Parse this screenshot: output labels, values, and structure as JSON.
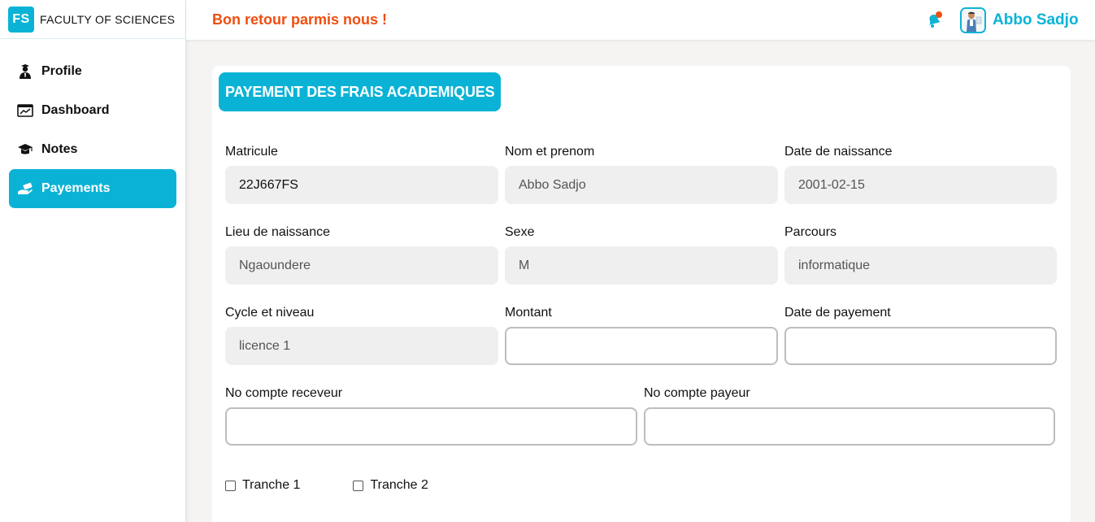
{
  "brand": {
    "logo": "FS",
    "name": "FACULTY OF SCIENCES"
  },
  "sidebar": {
    "items": [
      {
        "label": "Profile",
        "icon": "student-icon"
      },
      {
        "label": "Dashboard",
        "icon": "dashboard-icon"
      },
      {
        "label": "Notes",
        "icon": "graduation-cap-icon"
      },
      {
        "label": "Payements",
        "icon": "hand-money-icon",
        "active": true
      }
    ]
  },
  "header": {
    "welcome": "Bon retour parmis nous !",
    "username": "Abbo Sadjo"
  },
  "form": {
    "title": "PAYEMENT DES FRAIS ACADEMIQUES",
    "matricule": {
      "label": "Matricule",
      "value": "22J667FS"
    },
    "nom": {
      "label": "Nom et prenom",
      "value": "Abbo Sadjo"
    },
    "date_naissance": {
      "label": "Date de naissance",
      "value": "2001-02-15"
    },
    "lieu_naissance": {
      "label": "Lieu de naissance",
      "value": "Ngaoundere"
    },
    "sexe": {
      "label": "Sexe",
      "value": "M"
    },
    "parcours": {
      "label": "Parcours",
      "value": "informatique"
    },
    "cycle": {
      "label": "Cycle et niveau",
      "value": "licence 1"
    },
    "montant": {
      "label": "Montant",
      "value": ""
    },
    "date_payement": {
      "label": "Date de payement",
      "value": ""
    },
    "compte_receveur": {
      "label": "No compte receveur",
      "value": ""
    },
    "compte_payeur": {
      "label": "No compte payeur",
      "value": ""
    },
    "tranche1": "Tranche 1",
    "tranche2": "Tranche 2"
  },
  "colors": {
    "accent": "#0ab3d6",
    "welcome": "#f04e0e",
    "notification_dot": "#f04e0e"
  }
}
